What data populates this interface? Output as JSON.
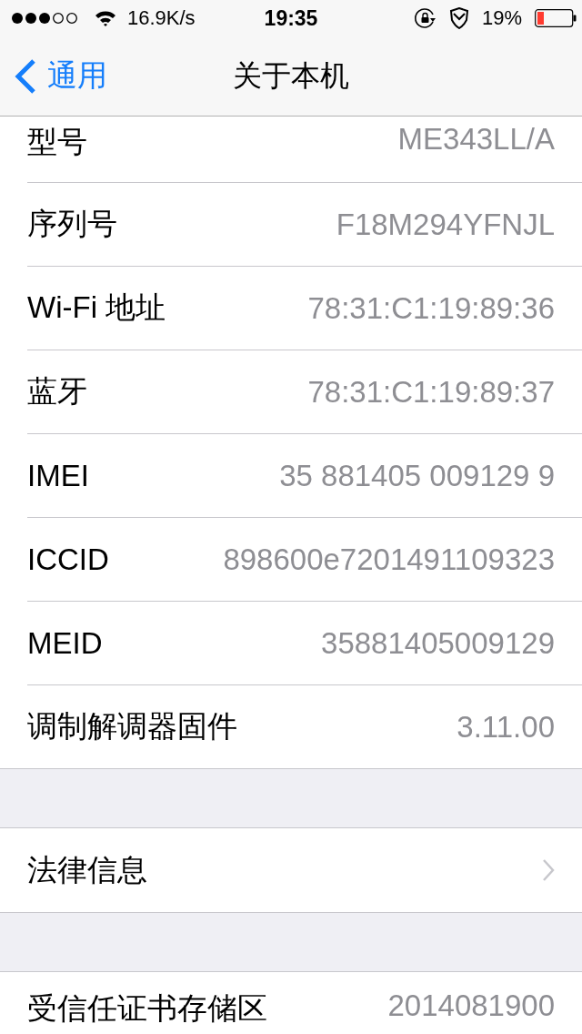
{
  "status_bar": {
    "network_speed": "16.9K/s",
    "time": "19:35",
    "battery": "19%"
  },
  "nav_bar": {
    "back": "通用",
    "title": "关于本机"
  },
  "sections": [
    {
      "rows": [
        {
          "label": "型号",
          "value": "ME343LL/A"
        },
        {
          "label": "序列号",
          "value": "F18M294YFNJL"
        },
        {
          "label": "Wi-Fi 地址",
          "value": "78:31:C1:19:89:36"
        },
        {
          "label": "蓝牙",
          "value": "78:31:C1:19:89:37"
        },
        {
          "label": "IMEI",
          "value": "35 881405 009129 9"
        },
        {
          "label": "ICCID",
          "value": "898600e7201491109323"
        },
        {
          "label": "MEID",
          "value": "35881405009129"
        },
        {
          "label": "调制解调器固件",
          "value": "3.11.00"
        }
      ]
    },
    {
      "rows": [
        {
          "label": "法律信息",
          "kind": "link"
        }
      ]
    },
    {
      "rows": [
        {
          "label": "受信任证书存储区",
          "value": "2014081900"
        }
      ]
    }
  ]
}
